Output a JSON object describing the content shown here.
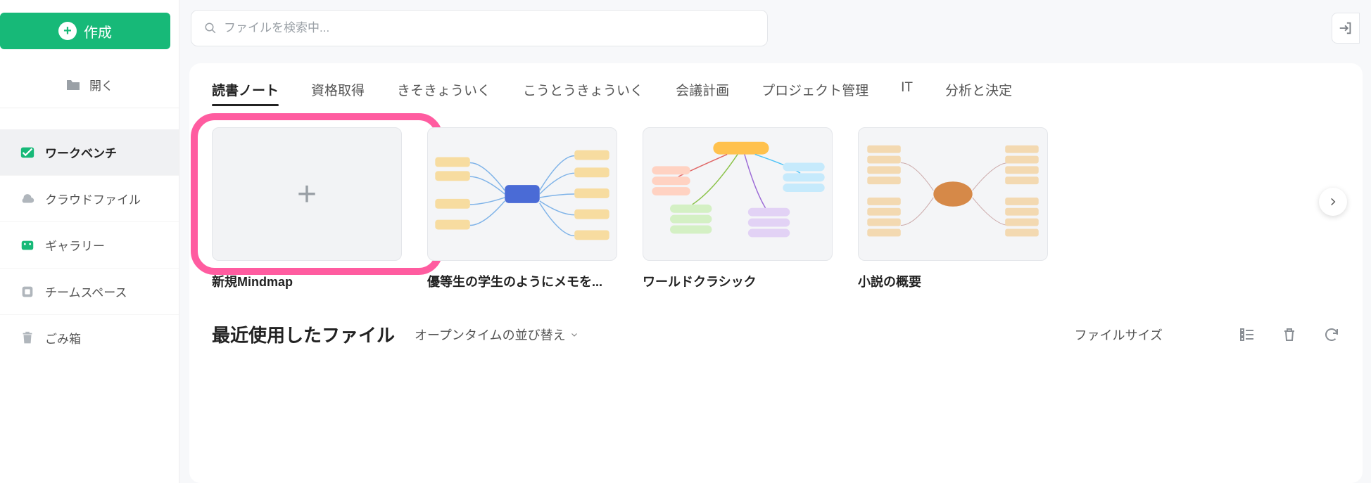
{
  "sidebar": {
    "create_label": "作成",
    "open_label": "開く",
    "items": [
      {
        "label": "ワークベンチ",
        "icon": "workbench-icon",
        "active": true
      },
      {
        "label": "クラウドファイル",
        "icon": "cloud-icon",
        "active": false
      },
      {
        "label": "ギャラリー",
        "icon": "gallery-icon",
        "active": false
      },
      {
        "label": "チームスペース",
        "icon": "team-icon",
        "active": false
      },
      {
        "label": "ごみ箱",
        "icon": "trash-icon",
        "active": false
      }
    ]
  },
  "search": {
    "placeholder": "ファイルを検索中..."
  },
  "tabs": [
    {
      "label": "読書ノート",
      "active": true
    },
    {
      "label": "資格取得",
      "active": false
    },
    {
      "label": "きそきょういく",
      "active": false
    },
    {
      "label": "こうとうきょういく",
      "active": false
    },
    {
      "label": "会議計画",
      "active": false
    },
    {
      "label": "プロジェクト管理",
      "active": false
    },
    {
      "label": "IT",
      "active": false
    },
    {
      "label": "分析と決定",
      "active": false
    }
  ],
  "templates": [
    {
      "title": "新規Mindmap",
      "type": "new"
    },
    {
      "title": "優等生の学生のようにメモを...",
      "type": "mindmap1"
    },
    {
      "title": "ワールドクラシック",
      "type": "mindmap2"
    },
    {
      "title": "小説の概要",
      "type": "mindmap3"
    }
  ],
  "recent": {
    "title": "最近使用したファイル",
    "sort_label": "オープンタイムの並び替え",
    "filesize_label": "ファイルサイズ"
  }
}
